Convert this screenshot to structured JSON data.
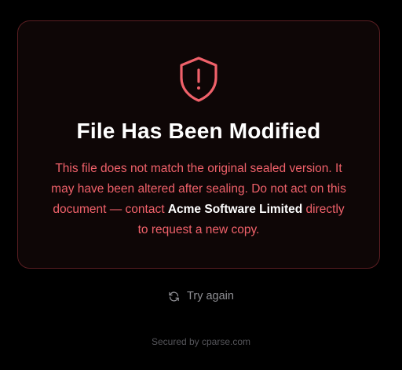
{
  "card": {
    "icon": "shield-alert-icon",
    "title": "File Has Been Modified",
    "message_part1": "This file does not match the original sealed version. It may have been altered after sealing. Do not act on this document — contact ",
    "company": "Acme Software Limited",
    "message_part2": " directly to request a new copy."
  },
  "retry": {
    "icon": "refresh-icon",
    "label": "Try again"
  },
  "footer": {
    "text": "Secured by cparse.com"
  },
  "colors": {
    "background": "#000000",
    "card_background": "#0e0606",
    "card_border": "#5a1e22",
    "accent_red": "#f0616a",
    "title_white": "#ffffff",
    "muted_gray": "#8f8f94"
  }
}
